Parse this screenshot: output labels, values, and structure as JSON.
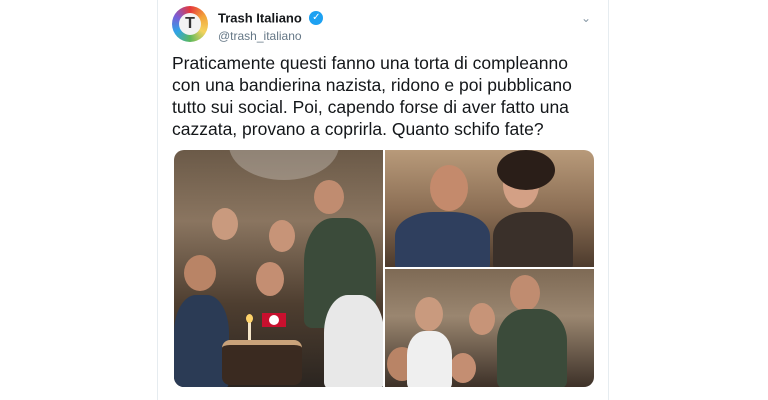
{
  "account": {
    "display_name": "Trash Italiano",
    "handle": "@trash_italiano",
    "avatar_letter": "T"
  },
  "tweet": {
    "text": "Praticamente questi fanno una torta di compleanno con una bandierina nazista, ridono e poi pubblicano tutto sui social. Poi, capendo forse di aver fatto una cazzata, provano a coprirla. Quanto schifo fate?"
  },
  "icons": {
    "verified": "verified-badge-icon",
    "menu": "chevron-down-icon"
  },
  "colors": {
    "verified": "#1da1f2",
    "handle": "#657786",
    "text": "#14171a"
  },
  "media": {
    "photo_count": 3
  }
}
